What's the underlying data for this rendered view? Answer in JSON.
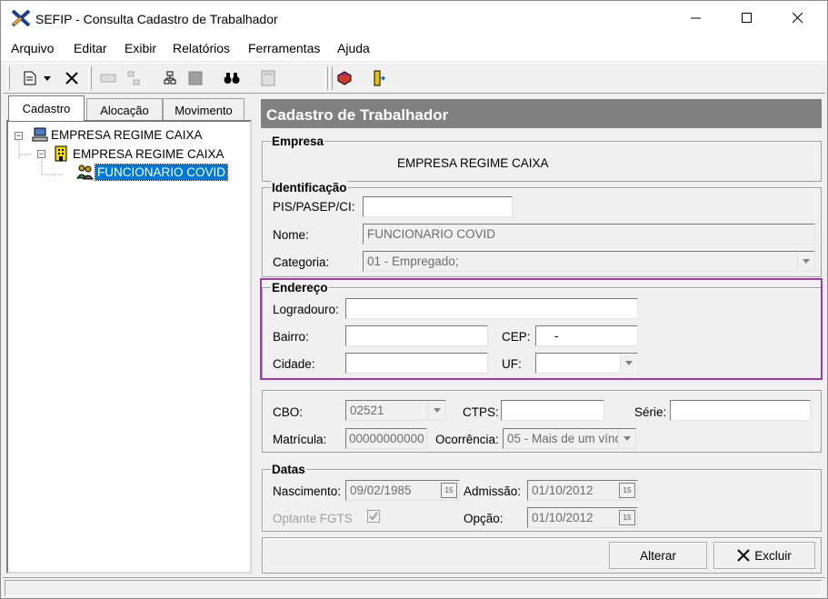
{
  "window": {
    "title": "SEFIP - Consulta Cadastro de Trabalhador"
  },
  "menu": [
    "Arquivo",
    "Editar",
    "Exibir",
    "Relatórios",
    "Ferramentas",
    "Ajuda"
  ],
  "tabs": [
    "Cadastro",
    "Alocação",
    "Movimento"
  ],
  "tree": {
    "root": "EMPRESA REGIME CAIXA",
    "company": "EMPRESA REGIME CAIXA",
    "worker": "FUNCIONARIO COVID"
  },
  "panel": {
    "header": "Cadastro de Trabalhador"
  },
  "empresa": {
    "title": "Empresa",
    "name": "EMPRESA REGIME CAIXA"
  },
  "identificacao": {
    "title": "Identificação",
    "pis_label": "PIS/PASEP/CI:",
    "pis_value": "",
    "nome_label": "Nome:",
    "nome_value": "FUNCIONARIO COVID",
    "categoria_label": "Categoria:",
    "categoria_value": "01 - Empregado;"
  },
  "endereco": {
    "title": "Endereço",
    "logradouro_label": "Logradouro:",
    "logradouro_value": "",
    "bairro_label": "Bairro:",
    "bairro_value": "",
    "cep_label": "CEP:",
    "cep_value": "-",
    "cidade_label": "Cidade:",
    "cidade_value": "",
    "uf_label": "UF:",
    "uf_value": ""
  },
  "vinculo": {
    "cbo_label": "CBO:",
    "cbo_value": "02521",
    "ctps_label": "CTPS:",
    "ctps_value": "",
    "serie_label": "Série:",
    "serie_value": "",
    "matricula_label": "Matrícula:",
    "matricula_value": "00000000000",
    "ocorrencia_label": "Ocorrência:",
    "ocorrencia_value": "05 - Mais de um vínc"
  },
  "datas": {
    "title": "Datas",
    "nascimento_label": "Nascimento:",
    "nascimento_value": "09/02/1985",
    "admissao_label": "Admissão:",
    "admissao_value": "01/10/2012",
    "optante_label": "Optante FGTS",
    "opcao_label": "Opção:",
    "opcao_value": "01/10/2012"
  },
  "buttons": {
    "alterar": "Alterar",
    "excluir": "Excluir"
  },
  "colors": {
    "highlight": "#9b3da5",
    "selection": "#0078d7",
    "header_bg": "#808080"
  }
}
